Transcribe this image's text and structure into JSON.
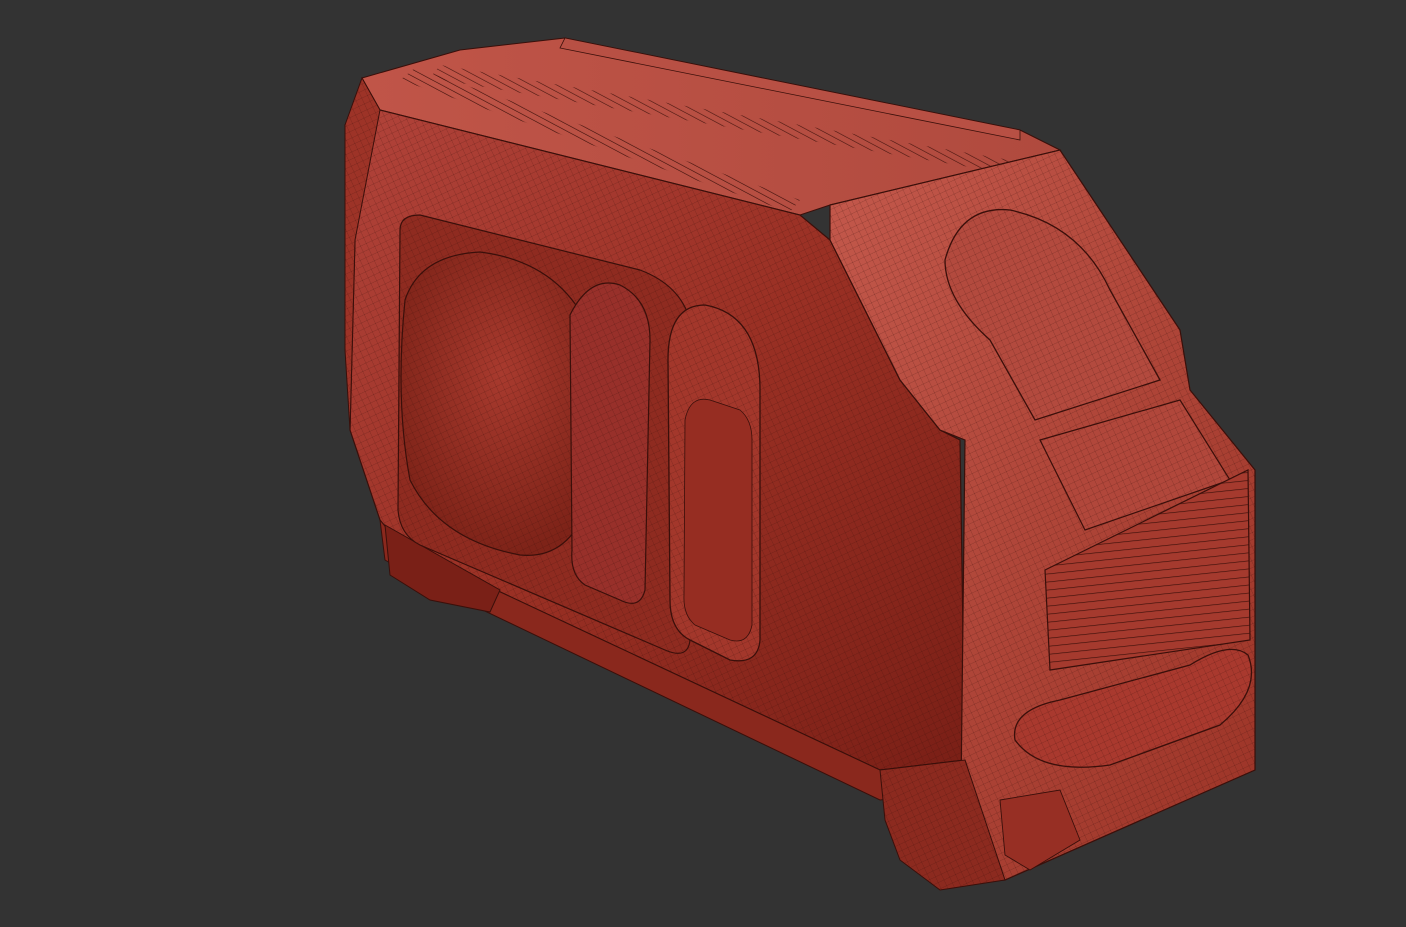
{
  "viewport": {
    "background_color": "#333333"
  },
  "model": {
    "description_icon": "wireframe-mesh",
    "colors": {
      "face_dark": "#7a2018",
      "face_mid": "#a8392c",
      "face_light": "#c8574a",
      "face_highlight": "#d8786a",
      "edge_wire": "#3a0f0a"
    }
  }
}
